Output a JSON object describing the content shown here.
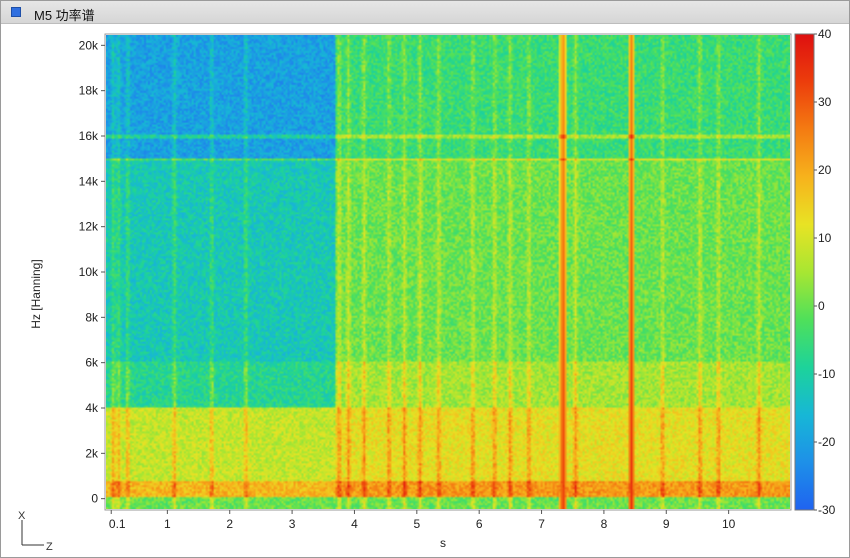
{
  "window": {
    "title": "M5 功率谱"
  },
  "colors": {
    "icon": "#2f6fe0",
    "grid": "#d0d0d0"
  },
  "colorbar_stops": [
    "#1f63f0",
    "#1e90e8",
    "#17b7d6",
    "#1dd39a",
    "#4fe05a",
    "#a8e632",
    "#e8e324",
    "#f7b21c",
    "#f47b12",
    "#ec3d0c",
    "#de1010"
  ],
  "chart_data": {
    "type": "heatmap",
    "title": "",
    "xlabel": "s",
    "ylabel": "Hz [Hanning]",
    "xlim": [
      0,
      11
    ],
    "ylim": [
      -500,
      20500
    ],
    "x_ticks": [
      {
        "v": 0.1,
        "label": "0.1"
      },
      {
        "v": 1,
        "label": "1"
      },
      {
        "v": 2,
        "label": "2"
      },
      {
        "v": 3,
        "label": "3"
      },
      {
        "v": 4,
        "label": "4"
      },
      {
        "v": 5,
        "label": "5"
      },
      {
        "v": 6,
        "label": "6"
      },
      {
        "v": 7,
        "label": "7"
      },
      {
        "v": 8,
        "label": "8"
      },
      {
        "v": 9,
        "label": "9"
      },
      {
        "v": 10,
        "label": "10"
      }
    ],
    "y_ticks": [
      {
        "v": 0,
        "label": "0"
      },
      {
        "v": 2000,
        "label": "2k"
      },
      {
        "v": 4000,
        "label": "4k"
      },
      {
        "v": 6000,
        "label": "6k"
      },
      {
        "v": 8000,
        "label": "8k"
      },
      {
        "v": 10000,
        "label": "10k"
      },
      {
        "v": 12000,
        "label": "12k"
      },
      {
        "v": 14000,
        "label": "14k"
      },
      {
        "v": 16000,
        "label": "16k"
      },
      {
        "v": 18000,
        "label": "18k"
      },
      {
        "v": 20000,
        "label": "20k"
      }
    ],
    "colorbar": {
      "min": -30,
      "max": 40,
      "ticks": [
        {
          "v": 40,
          "label": "40"
        },
        {
          "v": 30,
          "label": "30"
        },
        {
          "v": 20,
          "label": "20"
        },
        {
          "v": 10,
          "label": "10"
        },
        {
          "v": 0,
          "label": "0"
        },
        {
          "v": -10,
          "label": "-10"
        },
        {
          "v": -20,
          "label": "-20"
        },
        {
          "v": -30,
          "label": "-30"
        }
      ]
    },
    "axis_indicator": {
      "vertical": "X",
      "horizontal": "Z"
    },
    "approx_level": {
      "background_by_band": [
        {
          "from_hz": 15000,
          "to_hz": 20500,
          "x_before_3_7": -20,
          "x_after_3_7": -5
        },
        {
          "from_hz": 6000,
          "to_hz": 15000,
          "x_before_3_7": -12,
          "x_after_3_7": 0
        },
        {
          "from_hz": 4000,
          "to_hz": 6000,
          "x_before_3_7": -8,
          "x_after_3_7": 5
        },
        {
          "from_hz": 0,
          "to_hz": 4000,
          "x_before_3_7": 8,
          "x_after_3_7": 12
        }
      ],
      "horizontal_lines_hz": [
        15000,
        16000
      ],
      "vertical_event_times_s": [
        0.12,
        0.2,
        0.35,
        1.1,
        1.7,
        2.25,
        3.75,
        3.9,
        4.15,
        4.55,
        4.8,
        5.05,
        5.35,
        5.9,
        6.25,
        6.5,
        6.8,
        7.35,
        7.55,
        8.45,
        8.95,
        9.55,
        9.85,
        10.5
      ],
      "strongest_events_s": [
        7.35,
        8.45
      ],
      "strong_event_level": 35
    }
  }
}
